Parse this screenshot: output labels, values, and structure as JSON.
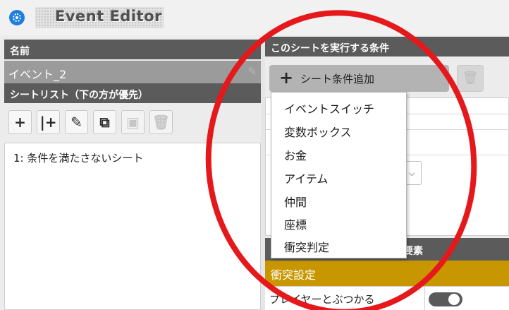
{
  "app": {
    "title": "Event Editor",
    "logo_icon": "event-logo-icon"
  },
  "left_panel": {
    "name_header": "名前",
    "event_name": "イベント_2",
    "sheet_list_header": "シートリスト（下の方が優先）",
    "toolbar": [
      {
        "icon": "plus-icon",
        "glyph": "+",
        "enabled": true
      },
      {
        "icon": "insert-icon",
        "glyph": "|+",
        "enabled": true
      },
      {
        "icon": "pencil-icon",
        "glyph": "✎",
        "enabled": true
      },
      {
        "icon": "copy-icon",
        "glyph": "⧉",
        "enabled": true
      },
      {
        "icon": "paste-icon",
        "glyph": "▣",
        "enabled": false
      },
      {
        "icon": "trash-icon",
        "glyph": "🗑",
        "enabled": false
      }
    ],
    "sheets": [
      "1: 条件を満たさないシート"
    ]
  },
  "right_panel": {
    "conditions_header": "このシートを実行する条件",
    "add_condition_label": "シート条件追加",
    "dropdown_options": [
      "イベントスイッチ",
      "変数ボックス",
      "お金",
      "アイテム",
      "仲間",
      "座標",
      "衝突判定"
    ],
    "lower_header_left": "",
    "lower_header_right": "要素",
    "collision_section": "衝突設定",
    "player_collide_label": "プレイヤーとぶつかる",
    "player_collide_on": true
  },
  "colors": {
    "header_gray": "#5b5b5b",
    "selected_gray": "#9b9b9b",
    "accent_gold": "#c89700",
    "annotation_red": "#e5191c",
    "logo_blue": "#1d7fe0"
  }
}
